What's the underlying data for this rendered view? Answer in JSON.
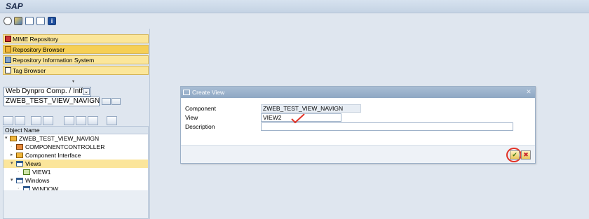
{
  "app": {
    "title": "SAP"
  },
  "toolbar": {
    "icons": [
      "transaction-icon",
      "display-icon",
      "object-list-icon",
      "settings-icon",
      "info-icon"
    ]
  },
  "left_panel": {
    "nav_items": [
      {
        "label": "MIME Repository",
        "icon": "mime-icon",
        "active": false
      },
      {
        "label": "Repository Browser",
        "icon": "repository-browser-icon",
        "active": true
      },
      {
        "label": "Repository Information System",
        "icon": "repo-info-icon",
        "active": false
      },
      {
        "label": "Tag Browser",
        "icon": "tag-browser-icon",
        "active": false
      }
    ],
    "object_type_select": "Web Dynpro Comp. / Intf.",
    "object_name_input": "ZWEB_TEST_VIEW_NAVIGN",
    "tree": {
      "header": "Object Name",
      "rows": [
        {
          "label": "ZWEB_TEST_VIEW_NAVIGN",
          "level": 0,
          "expander": "▾",
          "icon": "component-icon",
          "highlighted": false
        },
        {
          "label": "COMPONENTCONTROLLER",
          "level": 1,
          "expander": "·",
          "icon": "controller-icon",
          "highlighted": false
        },
        {
          "label": "Component Interface",
          "level": 1,
          "expander": "▸",
          "icon": "interface-icon",
          "highlighted": false
        },
        {
          "label": "Views",
          "level": 1,
          "expander": "▾",
          "icon": "folder-icon",
          "highlighted": true
        },
        {
          "label": "VIEW1",
          "level": 2,
          "expander": "·",
          "icon": "view-icon",
          "highlighted": false
        },
        {
          "label": "Windows",
          "level": 1,
          "expander": "▾",
          "icon": "folder-icon",
          "highlighted": false
        },
        {
          "label": "WINDOW",
          "level": 2,
          "expander": "·",
          "icon": "window-icon",
          "highlighted": false
        }
      ]
    }
  },
  "dialog": {
    "title": "Create View",
    "fields": [
      {
        "label": "Component",
        "value": "ZWEB_TEST_VIEW_NAVIGN",
        "editable": false
      },
      {
        "label": "View",
        "value": "VIEW2",
        "editable": true
      },
      {
        "label": "Description",
        "value": "",
        "editable": true
      }
    ],
    "buttons": {
      "ok": "✔",
      "cancel": "✖"
    }
  },
  "colors": {
    "annotation": "#e23327",
    "highlight": "#fbe59b",
    "nav_active": "#f6cf55"
  }
}
